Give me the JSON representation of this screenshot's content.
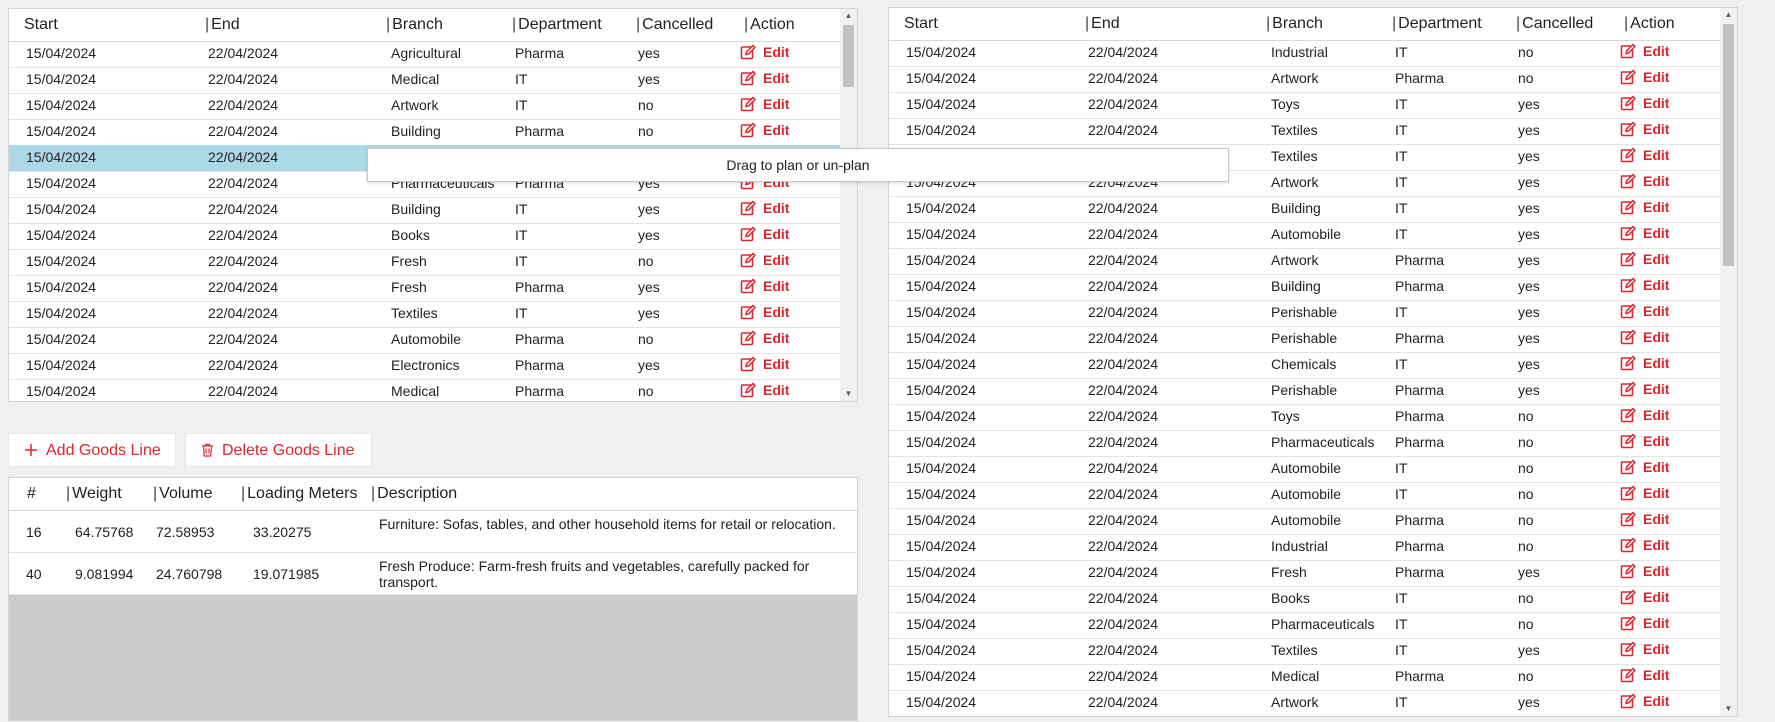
{
  "columns": [
    "Start",
    "End",
    "Branch",
    "Department",
    "Cancelled",
    "Action"
  ],
  "tooltip": "Drag to plan or un-plan",
  "left_rows": [
    {
      "start": "15/04/2024",
      "end": "22/04/2024",
      "branch": "Agricultural",
      "department": "Pharma",
      "cancelled": "yes",
      "action": "Edit"
    },
    {
      "start": "15/04/2024",
      "end": "22/04/2024",
      "branch": "Medical",
      "department": "IT",
      "cancelled": "yes",
      "action": "Edit"
    },
    {
      "start": "15/04/2024",
      "end": "22/04/2024",
      "branch": "Artwork",
      "department": "IT",
      "cancelled": "no",
      "action": "Edit"
    },
    {
      "start": "15/04/2024",
      "end": "22/04/2024",
      "branch": "Building",
      "department": "Pharma",
      "cancelled": "no",
      "action": "Edit"
    },
    {
      "start": "15/04/2024",
      "end": "22/04/2024",
      "branch": "",
      "department": "",
      "cancelled": "",
      "action": "",
      "selected": true
    },
    {
      "start": "15/04/2024",
      "end": "22/04/2024",
      "branch": "Pharmaceuticals",
      "department": "Pharma",
      "cancelled": "yes",
      "action": "Edit"
    },
    {
      "start": "15/04/2024",
      "end": "22/04/2024",
      "branch": "Building",
      "department": "IT",
      "cancelled": "yes",
      "action": "Edit"
    },
    {
      "start": "15/04/2024",
      "end": "22/04/2024",
      "branch": "Books",
      "department": "IT",
      "cancelled": "yes",
      "action": "Edit"
    },
    {
      "start": "15/04/2024",
      "end": "22/04/2024",
      "branch": "Fresh",
      "department": "IT",
      "cancelled": "no",
      "action": "Edit"
    },
    {
      "start": "15/04/2024",
      "end": "22/04/2024",
      "branch": "Fresh",
      "department": "Pharma",
      "cancelled": "yes",
      "action": "Edit"
    },
    {
      "start": "15/04/2024",
      "end": "22/04/2024",
      "branch": "Textiles",
      "department": "IT",
      "cancelled": "yes",
      "action": "Edit"
    },
    {
      "start": "15/04/2024",
      "end": "22/04/2024",
      "branch": "Automobile",
      "department": "Pharma",
      "cancelled": "no",
      "action": "Edit"
    },
    {
      "start": "15/04/2024",
      "end": "22/04/2024",
      "branch": "Electronics",
      "department": "Pharma",
      "cancelled": "yes",
      "action": "Edit"
    },
    {
      "start": "15/04/2024",
      "end": "22/04/2024",
      "branch": "Medical",
      "department": "Pharma",
      "cancelled": "no",
      "action": "Edit"
    }
  ],
  "right_rows": [
    {
      "start": "15/04/2024",
      "end": "22/04/2024",
      "branch": "Industrial",
      "department": "IT",
      "cancelled": "no",
      "action": "Edit"
    },
    {
      "start": "15/04/2024",
      "end": "22/04/2024",
      "branch": "Artwork",
      "department": "Pharma",
      "cancelled": "no",
      "action": "Edit"
    },
    {
      "start": "15/04/2024",
      "end": "22/04/2024",
      "branch": "Toys",
      "department": "IT",
      "cancelled": "yes",
      "action": "Edit"
    },
    {
      "start": "15/04/2024",
      "end": "22/04/2024",
      "branch": "Textiles",
      "department": "IT",
      "cancelled": "yes",
      "action": "Edit"
    },
    {
      "start": "",
      "end": "",
      "branch": "Textiles",
      "department": "IT",
      "cancelled": "yes",
      "action": "Edit"
    },
    {
      "start": "15/04/2024",
      "end": "22/04/2024",
      "branch": "Artwork",
      "department": "IT",
      "cancelled": "yes",
      "action": "Edit"
    },
    {
      "start": "15/04/2024",
      "end": "22/04/2024",
      "branch": "Building",
      "department": "IT",
      "cancelled": "yes",
      "action": "Edit"
    },
    {
      "start": "15/04/2024",
      "end": "22/04/2024",
      "branch": "Automobile",
      "department": "IT",
      "cancelled": "yes",
      "action": "Edit"
    },
    {
      "start": "15/04/2024",
      "end": "22/04/2024",
      "branch": "Artwork",
      "department": "Pharma",
      "cancelled": "yes",
      "action": "Edit"
    },
    {
      "start": "15/04/2024",
      "end": "22/04/2024",
      "branch": "Building",
      "department": "Pharma",
      "cancelled": "yes",
      "action": "Edit"
    },
    {
      "start": "15/04/2024",
      "end": "22/04/2024",
      "branch": "Perishable",
      "department": "IT",
      "cancelled": "yes",
      "action": "Edit"
    },
    {
      "start": "15/04/2024",
      "end": "22/04/2024",
      "branch": "Perishable",
      "department": "Pharma",
      "cancelled": "yes",
      "action": "Edit"
    },
    {
      "start": "15/04/2024",
      "end": "22/04/2024",
      "branch": "Chemicals",
      "department": "IT",
      "cancelled": "yes",
      "action": "Edit"
    },
    {
      "start": "15/04/2024",
      "end": "22/04/2024",
      "branch": "Perishable",
      "department": "Pharma",
      "cancelled": "yes",
      "action": "Edit"
    },
    {
      "start": "15/04/2024",
      "end": "22/04/2024",
      "branch": "Toys",
      "department": "Pharma",
      "cancelled": "no",
      "action": "Edit"
    },
    {
      "start": "15/04/2024",
      "end": "22/04/2024",
      "branch": "Pharmaceuticals",
      "department": "Pharma",
      "cancelled": "no",
      "action": "Edit"
    },
    {
      "start": "15/04/2024",
      "end": "22/04/2024",
      "branch": "Automobile",
      "department": "IT",
      "cancelled": "no",
      "action": "Edit"
    },
    {
      "start": "15/04/2024",
      "end": "22/04/2024",
      "branch": "Automobile",
      "department": "IT",
      "cancelled": "no",
      "action": "Edit"
    },
    {
      "start": "15/04/2024",
      "end": "22/04/2024",
      "branch": "Automobile",
      "department": "Pharma",
      "cancelled": "no",
      "action": "Edit"
    },
    {
      "start": "15/04/2024",
      "end": "22/04/2024",
      "branch": "Industrial",
      "department": "Pharma",
      "cancelled": "no",
      "action": "Edit"
    },
    {
      "start": "15/04/2024",
      "end": "22/04/2024",
      "branch": "Fresh",
      "department": "Pharma",
      "cancelled": "yes",
      "action": "Edit"
    },
    {
      "start": "15/04/2024",
      "end": "22/04/2024",
      "branch": "Books",
      "department": "IT",
      "cancelled": "no",
      "action": "Edit"
    },
    {
      "start": "15/04/2024",
      "end": "22/04/2024",
      "branch": "Pharmaceuticals",
      "department": "IT",
      "cancelled": "no",
      "action": "Edit"
    },
    {
      "start": "15/04/2024",
      "end": "22/04/2024",
      "branch": "Textiles",
      "department": "IT",
      "cancelled": "yes",
      "action": "Edit"
    },
    {
      "start": "15/04/2024",
      "end": "22/04/2024",
      "branch": "Medical",
      "department": "Pharma",
      "cancelled": "no",
      "action": "Edit"
    },
    {
      "start": "15/04/2024",
      "end": "22/04/2024",
      "branch": "Artwork",
      "department": "IT",
      "cancelled": "yes",
      "action": "Edit"
    }
  ],
  "buttons": {
    "add_label": "Add Goods Line",
    "delete_label": "Delete Goods Line"
  },
  "goods": {
    "columns": [
      "#",
      "Weight",
      "Volume",
      "Loading Meters",
      "Description"
    ],
    "rows": [
      {
        "num": "16",
        "weight": "64.75768",
        "volume": "72.58953",
        "loading_meters": "33.20275",
        "description": "Furniture: Sofas, tables, and other household items for retail or relocation."
      },
      {
        "num": "40",
        "weight": "9.081994",
        "volume": "24.760798",
        "loading_meters": "19.071985",
        "description": "Fresh Produce: Farm-fresh fruits and vegetables, carefully packed for transport."
      }
    ]
  },
  "colors": {
    "accent": "#e0262d",
    "selected_row": "#add8e6",
    "goods_empty_bg": "#cccccc"
  }
}
